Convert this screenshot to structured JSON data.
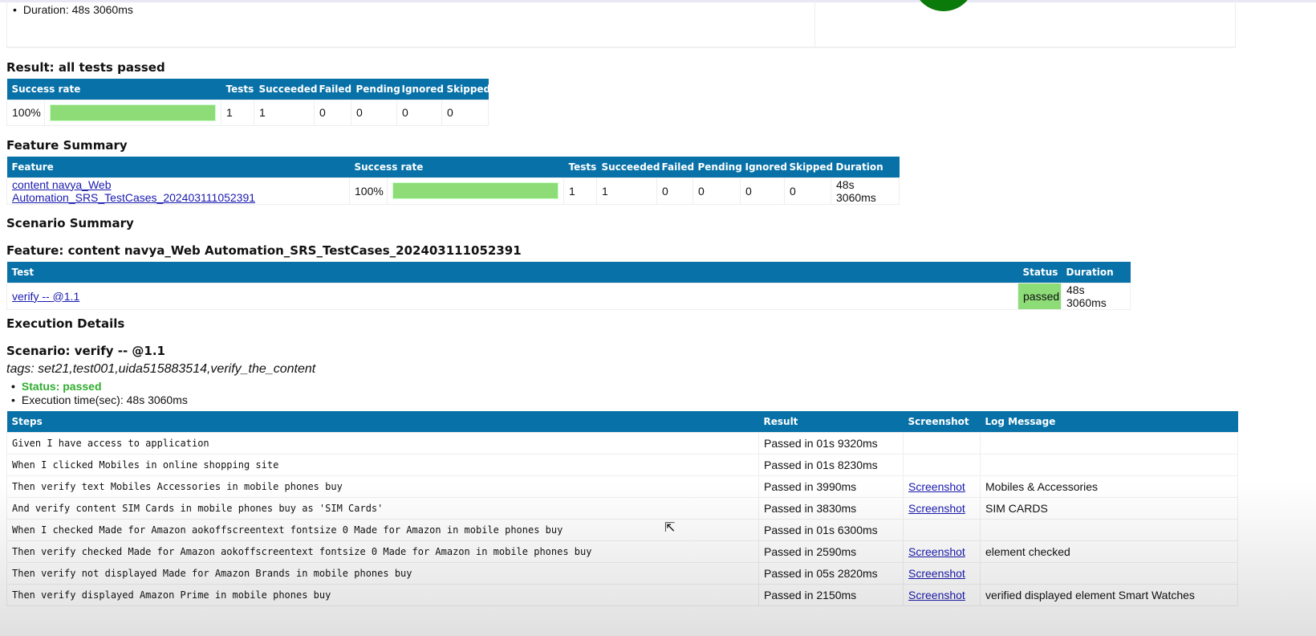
{
  "summary": {
    "duration": "Duration: 48s 3060ms"
  },
  "result": {
    "title": "Result: all tests passed",
    "headers": [
      "Success rate",
      "Tests",
      "Succeeded",
      "Failed",
      "Pending",
      "Ignored",
      "Skipped"
    ],
    "row": {
      "rate": "100%",
      "rate_value": 100,
      "tests": "1",
      "succeeded": "1",
      "failed": "0",
      "pending": "0",
      "ignored": "0",
      "skipped": "0"
    }
  },
  "feature_summary": {
    "title": "Feature Summary",
    "headers": [
      "Feature",
      "Success rate",
      "Tests",
      "Succeeded",
      "Failed",
      "Pending",
      "Ignored",
      "Skipped",
      "Duration"
    ],
    "row": {
      "feature": "content navya_Web Automation_SRS_TestCases_202403111052391",
      "rate": "100%",
      "rate_value": 100,
      "tests": "1",
      "succeeded": "1",
      "failed": "0",
      "pending": "0",
      "ignored": "0",
      "skipped": "0",
      "duration": "48s 3060ms"
    }
  },
  "scenario_summary": {
    "title": "Scenario Summary",
    "feature_title": "Feature: content navya_Web Automation_SRS_TestCases_202403111052391",
    "headers": [
      "Test",
      "Status",
      "Duration"
    ],
    "row": {
      "test": "verify -- @1.1",
      "status": "passed",
      "duration": "48s 3060ms"
    }
  },
  "execution": {
    "title": "Execution Details",
    "scenario": "Scenario: verify -- @1.1",
    "tags": "tags: set21,test001,uida515883514,verify_the_content",
    "status": "Status: passed",
    "exec_time": "Execution time(sec): 48s 3060ms",
    "headers": [
      "Steps",
      "Result",
      "Screenshot",
      "Log Message"
    ],
    "steps": [
      {
        "step": "Given I have access to application",
        "result": "Passed in 01s 9320ms",
        "screenshot": "",
        "log": ""
      },
      {
        "step": "When I clicked Mobiles in online shopping site",
        "result": "Passed in 01s 8230ms",
        "screenshot": "",
        "log": ""
      },
      {
        "step": "Then verify text Mobiles  Accessories in mobile phones buy",
        "result": "Passed in 3990ms",
        "screenshot": "Screenshot",
        "log": "Mobiles & Accessories"
      },
      {
        "step": "And verify content SIM Cards in mobile phones buy as 'SIM Cards'",
        "result": "Passed in 3830ms",
        "screenshot": "Screenshot",
        "log": "SIM CARDS"
      },
      {
        "step": "When I checked Made for Amazon aokoffscreentext  fontsize 0  Made for Amazon in mobile phones buy",
        "result": "Passed in 01s 6300ms",
        "screenshot": "",
        "log": ""
      },
      {
        "step": "Then verify checked Made for Amazon aokoffscreentext  fontsize 0  Made for Amazon in mobile phones buy",
        "result": "Passed in 2590ms",
        "screenshot": "Screenshot",
        "log": "element checked"
      },
      {
        "step": "Then verify not displayed Made for Amazon Brands in mobile phones buy",
        "result": "Passed in 05s 2820ms",
        "screenshot": "Screenshot",
        "log": ""
      },
      {
        "step": "Then verify displayed Amazon Prime in mobile phones buy",
        "result": "Passed in 2150ms",
        "screenshot": "Screenshot",
        "log": "verified displayed element Smart Watches"
      }
    ]
  },
  "colors": {
    "header": "#0771a8",
    "bar": "#8ddc78",
    "passed": "#2fad2f",
    "link": "#1a1ab0"
  }
}
